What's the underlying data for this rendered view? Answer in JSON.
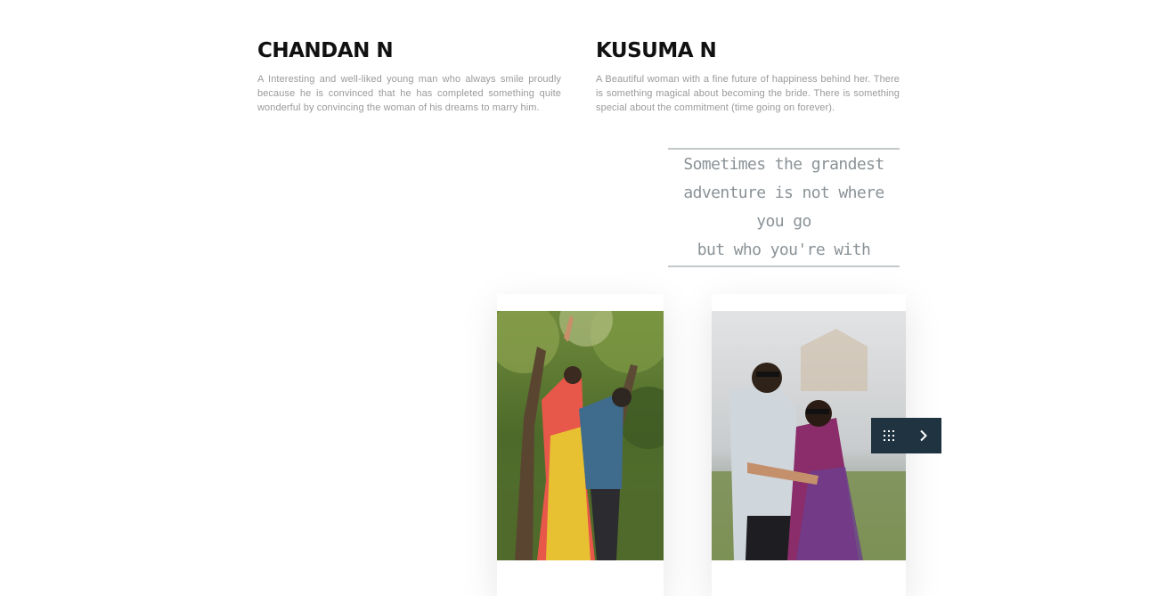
{
  "bios": [
    {
      "name": "CHANDAN N",
      "text": "A Interesting and well-liked young man who always smile proudly because he is convinced that he has completed something quite wonderful by convincing the woman of his dreams to marry him."
    },
    {
      "name": "KUSUMA N",
      "text": "A Beautiful woman with a fine future of happiness behind her. There is something magical about becoming the bride. There is something special about the commitment (time going on forever)."
    }
  ],
  "quote": {
    "lines": [
      "Sometimes the grandest",
      "adventure is not where you go",
      "but who you're with"
    ]
  },
  "nav": {
    "grid_icon": "grid-icon",
    "next_icon": "chevron-right-icon",
    "background": "#1f3440"
  },
  "colors": {
    "heading": "#111111",
    "body_text": "#9a9a9a",
    "quote_text": "#8a9296",
    "quote_rule": "#c3c9cb"
  }
}
